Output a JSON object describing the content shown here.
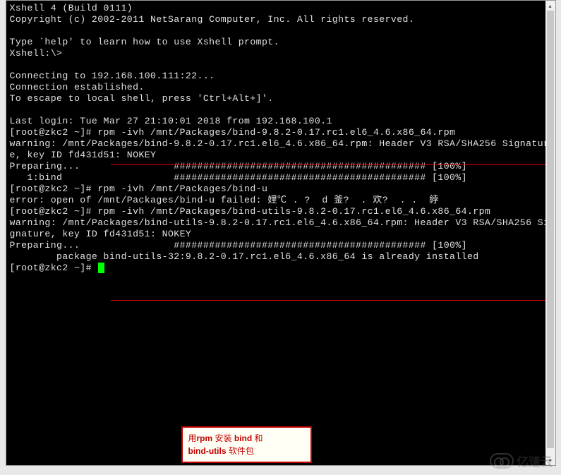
{
  "terminal": {
    "lines": [
      "Xshell 4 (Build 0111)",
      "Copyright (c) 2002-2011 NetSarang Computer, Inc. All rights reserved.",
      "",
      "Type `help' to learn how to use Xshell prompt.",
      "Xshell:\\>",
      "",
      "Connecting to 192.168.100.111:22...",
      "Connection established.",
      "To escape to local shell, press 'Ctrl+Alt+]'.",
      "",
      "Last login: Tue Mar 27 21:10:01 2018 from 192.168.100.1",
      "[root@zkc2 ~]# rpm -ivh /mnt/Packages/bind-9.8.2-0.17.rc1.el6_4.6.x86_64.rpm",
      "warning: /mnt/Packages/bind-9.8.2-0.17.rc1.el6_4.6.x86_64.rpm: Header V3 RSA/SHA256 Signature, key ID fd431d51: NOKEY",
      "Preparing...                ########################################### [100%]",
      "   1:bind                   ########################################### [100%]",
      "[root@zkc2 ~]# rpm -ivh /mnt/Packages/bind-u",
      "error: open of /mnt/Packages/bind-u failed: 娌℃ . ?  d 釜?  . 欢?  . .  綍",
      "[root@zkc2 ~]# rpm -ivh /mnt/Packages/bind-utils-9.8.2-0.17.rc1.el6_4.6.x86_64.rpm",
      "warning: /mnt/Packages/bind-utils-9.8.2-0.17.rc1.el6_4.6.x86_64.rpm: Header V3 RSA/SHA256 Signature, key ID fd431d51: NOKEY",
      "Preparing...                ########################################### [100%]",
      "        package bind-utils-32:9.8.2-0.17.rc1.el6_4.6.x86_64 is already installed",
      "[root@zkc2 ~]# "
    ],
    "prompt_with_cursor_index": 21
  },
  "annotation": {
    "line1_prefix": "用",
    "line1_bold1": "rpm",
    "line1_mid": " 安装 ",
    "line1_bold2": "bind",
    "line1_suffix": " 和",
    "line2_bold": "bind-utils",
    "line2_suffix": " 软件包"
  },
  "watermark": {
    "text": "亿速云"
  }
}
